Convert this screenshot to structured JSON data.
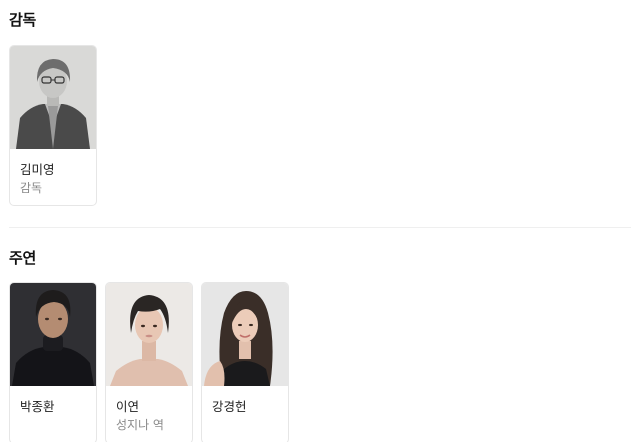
{
  "sections": {
    "director": {
      "title": "감독",
      "people": [
        {
          "name": "김미영",
          "role": "감독",
          "photo": "director-photo"
        }
      ]
    },
    "cast": {
      "title": "주연",
      "people": [
        {
          "name": "박종환",
          "role": "",
          "photo": "actor-photo"
        },
        {
          "name": "이연",
          "role": "성지나 역",
          "photo": "actress-photo"
        },
        {
          "name": "강경헌",
          "role": "",
          "photo": "actress-photo"
        }
      ]
    }
  },
  "colors": {
    "card_border": "#e6e6e6",
    "role_text": "#8a8a8a",
    "divider": "#efefef"
  }
}
